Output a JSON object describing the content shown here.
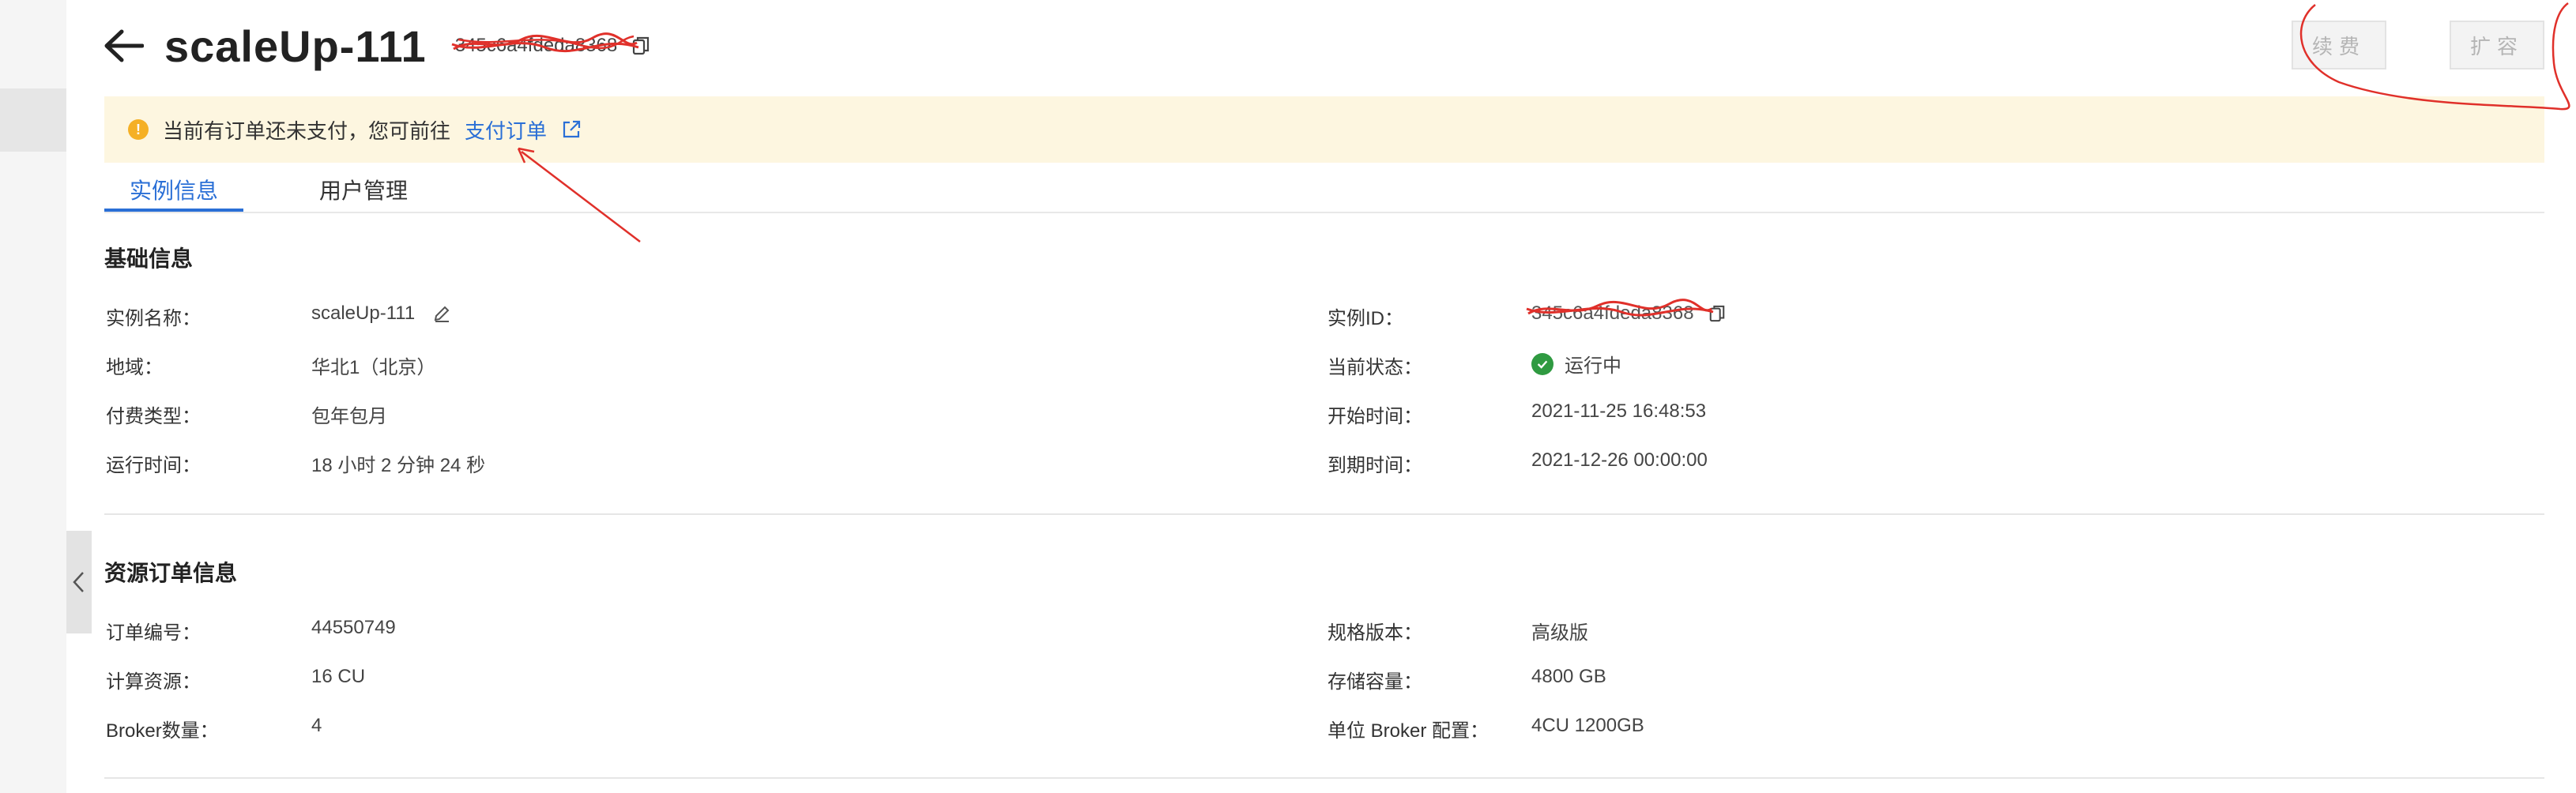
{
  "header": {
    "title": "scaleUp-111",
    "instance_id_masked": "345c6a4fdeda8368",
    "buttons": {
      "renew": "续费",
      "expand": "扩容"
    }
  },
  "notice": {
    "text": "当前有订单还未支付，您可前往",
    "link": "支付订单"
  },
  "tabs": [
    {
      "label": "实例信息",
      "active": true
    },
    {
      "label": "用户管理",
      "active": false
    }
  ],
  "basic_info": {
    "title": "基础信息",
    "left": [
      {
        "label": "实例名称：",
        "value": "scaleUp-111"
      },
      {
        "label": "地域：",
        "value": "华北1（北京）"
      },
      {
        "label": "付费类型：",
        "value": "包年包月"
      },
      {
        "label": "运行时间：",
        "value": "18 小时 2 分钟 24 秒"
      }
    ],
    "right": [
      {
        "label": "实例ID：",
        "value": "345c6a4fdeda8368"
      },
      {
        "label": "当前状态：",
        "value": "运行中"
      },
      {
        "label": "开始时间：",
        "value": "2021-11-25 16:48:53"
      },
      {
        "label": "到期时间：",
        "value": "2021-12-26 00:00:00"
      }
    ]
  },
  "order_info": {
    "title": "资源订单信息",
    "left": [
      {
        "label": "订单编号：",
        "value": "44550749"
      },
      {
        "label": "计算资源：",
        "value": "16 CU"
      },
      {
        "label": "Broker数量：",
        "value": "4"
      }
    ],
    "right": [
      {
        "label": "规格版本：",
        "value": "高级版"
      },
      {
        "label": "存储容量：",
        "value": "4800 GB"
      },
      {
        "label": "单位 Broker 配置：",
        "value": "4CU 1200GB"
      }
    ]
  },
  "colors": {
    "link_blue": "#2a6fd6",
    "notice_bg": "#fdf6e0",
    "warning": "#f5b025",
    "success": "#2f9a41",
    "annotation_red": "#e0302a"
  },
  "icons": [
    "back-arrow-icon",
    "copy-icon",
    "warning-icon",
    "external-link-icon",
    "edit-icon",
    "success-check-icon",
    "chevron-left-icon"
  ]
}
